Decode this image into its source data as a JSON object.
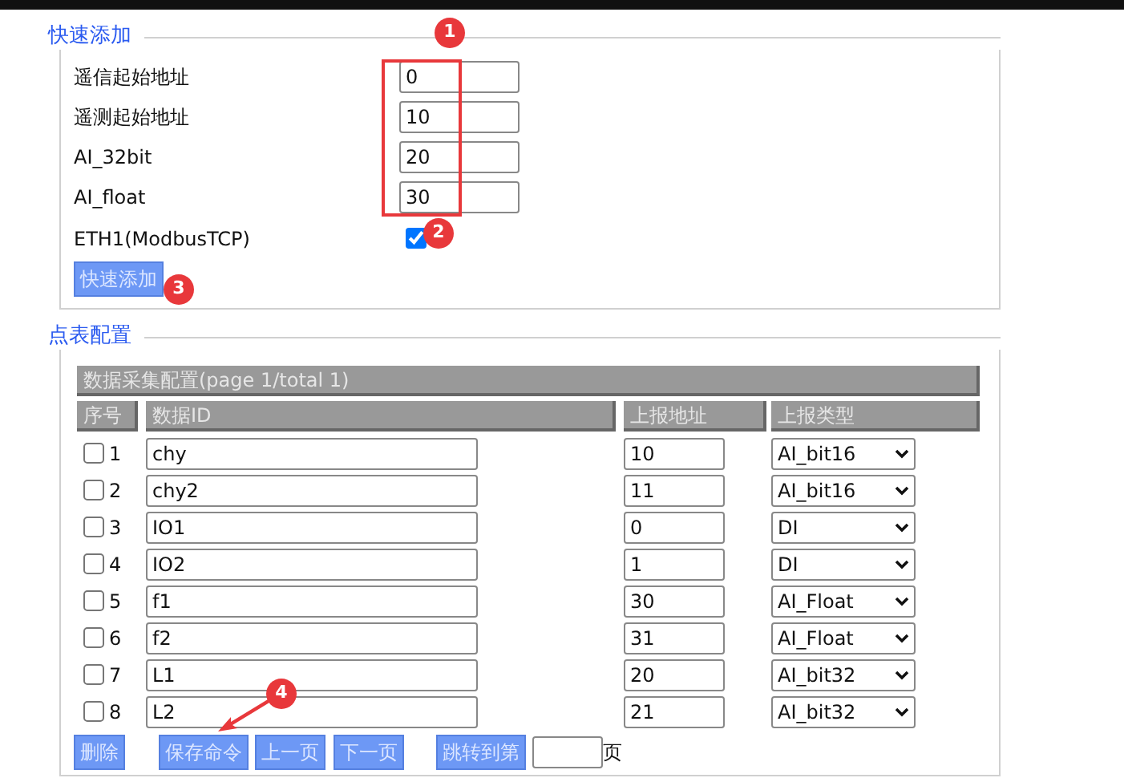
{
  "quick_add": {
    "legend": "快速添加",
    "fields": [
      {
        "label": "遥信起始地址",
        "value": "0"
      },
      {
        "label": "遥测起始地址",
        "value": "10"
      },
      {
        "label": "AI_32bit",
        "value": "20"
      },
      {
        "label": "AI_float",
        "value": "30"
      }
    ],
    "option": {
      "label": "ETH1(ModbusTCP)",
      "checked": true
    },
    "button": "快速添加"
  },
  "point_table": {
    "legend": "点表配置",
    "title": "数据采集配置(page 1/total 1)",
    "columns": [
      "序号",
      "数据ID",
      "上报地址",
      "上报类型"
    ],
    "rows": [
      {
        "checked": false,
        "index": "1",
        "data_id": "chy",
        "address": "10",
        "type": "AI_bit16"
      },
      {
        "checked": false,
        "index": "2",
        "data_id": "chy2",
        "address": "11",
        "type": "AI_bit16"
      },
      {
        "checked": false,
        "index": "3",
        "data_id": "IO1",
        "address": "0",
        "type": "DI"
      },
      {
        "checked": false,
        "index": "4",
        "data_id": "IO2",
        "address": "1",
        "type": "DI"
      },
      {
        "checked": false,
        "index": "5",
        "data_id": "f1",
        "address": "30",
        "type": "AI_Float"
      },
      {
        "checked": false,
        "index": "6",
        "data_id": "f2",
        "address": "31",
        "type": "AI_Float"
      },
      {
        "checked": false,
        "index": "7",
        "data_id": "L1",
        "address": "20",
        "type": "AI_bit32"
      },
      {
        "checked": false,
        "index": "8",
        "data_id": "L2",
        "address": "21",
        "type": "AI_bit32"
      }
    ],
    "buttons": [
      "删除",
      "保存命令",
      "上一页",
      "下一页",
      "跳转到第"
    ],
    "page_suffix": "页"
  },
  "annotations": [
    "1",
    "2",
    "3",
    "4"
  ]
}
